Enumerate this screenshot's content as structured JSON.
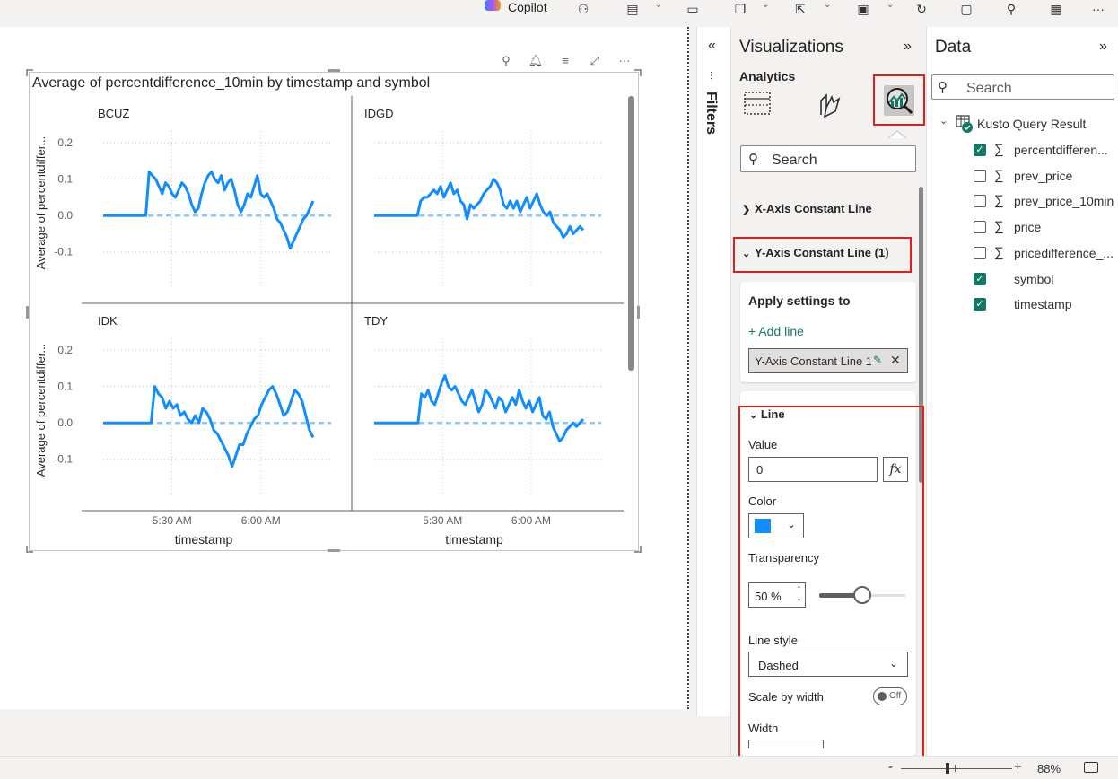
{
  "topbar": {
    "copilot_label": "Copilot",
    "icons": [
      "binoculars-icon",
      "comment-icon",
      "notes-icon",
      "copy-icon",
      "share-icon",
      "subscribe-icon",
      "refresh-icon",
      "save-icon",
      "pin-icon",
      "teams-icon",
      "more-icon"
    ]
  },
  "visual": {
    "title": "Average of percentdifference_10min by timestamp and symbol",
    "toolbar_icons": [
      "pin-icon",
      "bell-icon",
      "filter-icon",
      "focus-mode-icon",
      "more-options-icon"
    ]
  },
  "chart_data": {
    "type": "line",
    "layout": "small-multiples",
    "title": "Average of percentdifference_10min by timestamp and symbol",
    "xlabel": "timestamp",
    "ylabel": "Average of percentdiffer...",
    "x_ticks": [
      "5:30 AM",
      "6:00 AM"
    ],
    "y_ticks": [
      "0.2",
      "0.1",
      "0.0",
      "-0.1"
    ],
    "ylim": [
      -0.15,
      0.22
    ],
    "constant_line": {
      "value": 0,
      "style": "dashed",
      "color": "#118DFF",
      "transparency": 50
    },
    "line_color": "#118DFF",
    "panels": [
      {
        "name": "BCUZ",
        "values": [
          0,
          0,
          0,
          0,
          0,
          0,
          0,
          0,
          0,
          0,
          0,
          0,
          0,
          0,
          0.12,
          0.11,
          0.1,
          0.08,
          0.06,
          0.09,
          0.08,
          0.06,
          0.05,
          0.07,
          0.09,
          0.08,
          0.06,
          0.03,
          0.01,
          0.02,
          0.06,
          0.09,
          0.11,
          0.12,
          0.1,
          0.09,
          0.11,
          0.07,
          0.09,
          0.1,
          0.07,
          0.03,
          0.01,
          0.03,
          0.06,
          0.05,
          0.08,
          0.11,
          0.06,
          0.05,
          0.06,
          0.04,
          0.02,
          -0.01,
          -0.02,
          -0.04,
          -0.06,
          -0.09,
          -0.07,
          -0.05,
          -0.03,
          -0.01,
          0.0,
          0.02,
          0.04
        ]
      },
      {
        "name": "IDGD",
        "values": [
          0,
          0,
          0,
          0,
          0,
          0,
          0,
          0,
          0,
          0,
          0,
          0,
          0,
          0,
          0.04,
          0.05,
          0.05,
          0.06,
          0.07,
          0.06,
          0.08,
          0.05,
          0.07,
          0.09,
          0.06,
          0.07,
          0.04,
          0.03,
          -0.01,
          0.03,
          0.02,
          0.03,
          0.04,
          0.06,
          0.07,
          0.08,
          0.1,
          0.09,
          0.07,
          0.03,
          0.02,
          0.04,
          0.02,
          0.04,
          0.01,
          0.03,
          0.05,
          0.02,
          0.04,
          0.06,
          0.03,
          0.01,
          0.0,
          0.01,
          -0.02,
          -0.03,
          -0.04,
          -0.06,
          -0.05,
          -0.03,
          -0.05,
          -0.04,
          -0.03,
          -0.04
        ]
      },
      {
        "name": "IDK",
        "values": [
          0,
          0,
          0,
          0,
          0,
          0,
          0,
          0,
          0,
          0,
          0,
          0,
          0,
          0,
          0.1,
          0.08,
          0.07,
          0.04,
          0.06,
          0.04,
          0.05,
          0.02,
          0.03,
          0.01,
          0.0,
          0.02,
          0.0,
          0.04,
          0.03,
          0.01,
          -0.02,
          -0.03,
          -0.05,
          -0.07,
          -0.09,
          -0.12,
          -0.09,
          -0.06,
          -0.06,
          -0.03,
          -0.01,
          0.01,
          0.02,
          0.05,
          0.07,
          0.09,
          0.1,
          0.08,
          0.05,
          0.02,
          0.03,
          0.06,
          0.09,
          0.08,
          0.06,
          0.02,
          -0.02,
          -0.04
        ]
      },
      {
        "name": "TDY",
        "values": [
          0,
          0,
          0,
          0,
          0,
          0,
          0,
          0,
          0,
          0,
          0,
          0,
          0,
          0,
          0.08,
          0.07,
          0.09,
          0.06,
          0.05,
          0.08,
          0.11,
          0.13,
          0.1,
          0.09,
          0.1,
          0.08,
          0.06,
          0.05,
          0.07,
          0.09,
          0.06,
          0.03,
          0.05,
          0.09,
          0.08,
          0.06,
          0.04,
          0.07,
          0.06,
          0.03,
          0.05,
          0.07,
          0.05,
          0.09,
          0.06,
          0.04,
          0.06,
          0.03,
          0.05,
          0.07,
          0.02,
          0.01,
          0.03,
          -0.01,
          -0.03,
          -0.05,
          -0.04,
          -0.02,
          -0.01,
          0.0,
          -0.01,
          0.0,
          0.01
        ]
      }
    ]
  },
  "filters": {
    "label": "Filters",
    "collapse_glyph": "«"
  },
  "visualizations": {
    "title": "Visualizations",
    "expand_glyph": "»",
    "analytics_label": "Analytics",
    "search_placeholder": "Search",
    "sections": {
      "x_axis": "X-Axis Constant Line",
      "y_axis": "Y-Axis Constant Line (1)"
    },
    "apply_settings": {
      "title": "Apply settings to",
      "add_line": "+ Add line",
      "chip": "Y-Axis Constant Line 1"
    },
    "line": {
      "header": "Line",
      "value_label": "Value",
      "value": "0",
      "fx_label": "fx",
      "color_label": "Color",
      "color": "#118DFF",
      "transparency_label": "Transparency",
      "transparency_value": "50 %",
      "transparency_percent": 50,
      "line_style_label": "Line style",
      "line_style_value": "Dashed",
      "scale_by_width_label": "Scale by width",
      "scale_by_width_state": "Off",
      "width_label": "Width"
    }
  },
  "data_pane": {
    "title": "Data",
    "expand_glyph": "»",
    "search_placeholder": "Search",
    "table_name": "Kusto Query Result",
    "fields": [
      {
        "label": "percentdifferen...",
        "checked": true,
        "sigma": true
      },
      {
        "label": "prev_price",
        "checked": false,
        "sigma": true
      },
      {
        "label": "prev_price_10min",
        "checked": false,
        "sigma": true
      },
      {
        "label": "price",
        "checked": false,
        "sigma": true
      },
      {
        "label": "pricedifference_...",
        "checked": false,
        "sigma": true
      },
      {
        "label": "symbol",
        "checked": true,
        "sigma": false
      },
      {
        "label": "timestamp",
        "checked": true,
        "sigma": false
      }
    ]
  },
  "statusbar": {
    "zoom_label": "88%",
    "zoom_minus": "-",
    "zoom_plus": "+"
  }
}
